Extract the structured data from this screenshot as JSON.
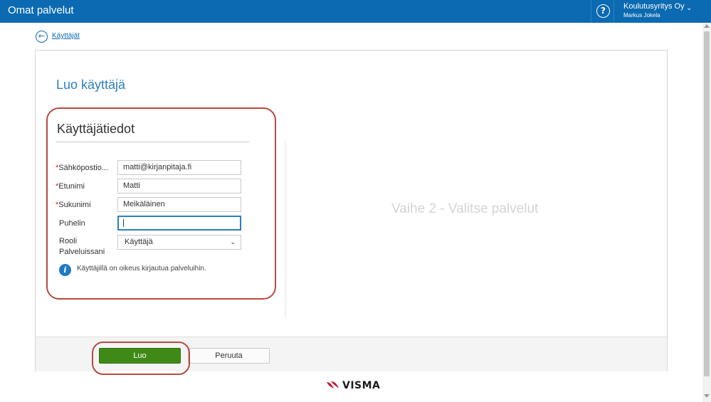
{
  "topbar": {
    "app_title": "Omat palvelut",
    "help_label": "?",
    "company": "Koulutusyritys Oy",
    "user": "Markus Jokela",
    "chevron": "⌄"
  },
  "back": {
    "icon": "arrow-left-icon",
    "glyph": "←",
    "label": "Käyttäjät"
  },
  "page": {
    "heading": "Luo käyttäjä",
    "section_title": "Käyttäjätiedot"
  },
  "form": {
    "required_mark": "*",
    "email_label": "Sähköpostio...",
    "email_value": "matti@kirjanpitaja.fi",
    "firstname_label": "Etunimi",
    "firstname_value": "Matti",
    "lastname_label": "Sukunimi",
    "lastname_value": "Meikäläinen",
    "phone_label": "Puhelin",
    "phone_value": "",
    "role_label_line1": "Rooli",
    "role_label_line2": "Palveluissani",
    "role_selected": "Käyttäjä",
    "role_chevron": "⌄",
    "info_glyph": "i",
    "info_text": "Käyttäjillä on oikeus kirjautua palveluihin."
  },
  "step2": {
    "label": "Vaihe 2 - Valitse palvelut"
  },
  "footer": {
    "create_label": "Luo",
    "cancel_label": "Peruuta"
  },
  "logo": {
    "wordmark": "VISMA"
  },
  "colors": {
    "header_blue": "#0b6ab1",
    "link_blue": "#2b7fc1",
    "create_green": "#3f8a17",
    "highlight_red": "#b84a3e",
    "required_red": "#cc2b2b",
    "logo_red": "#c8102e"
  }
}
